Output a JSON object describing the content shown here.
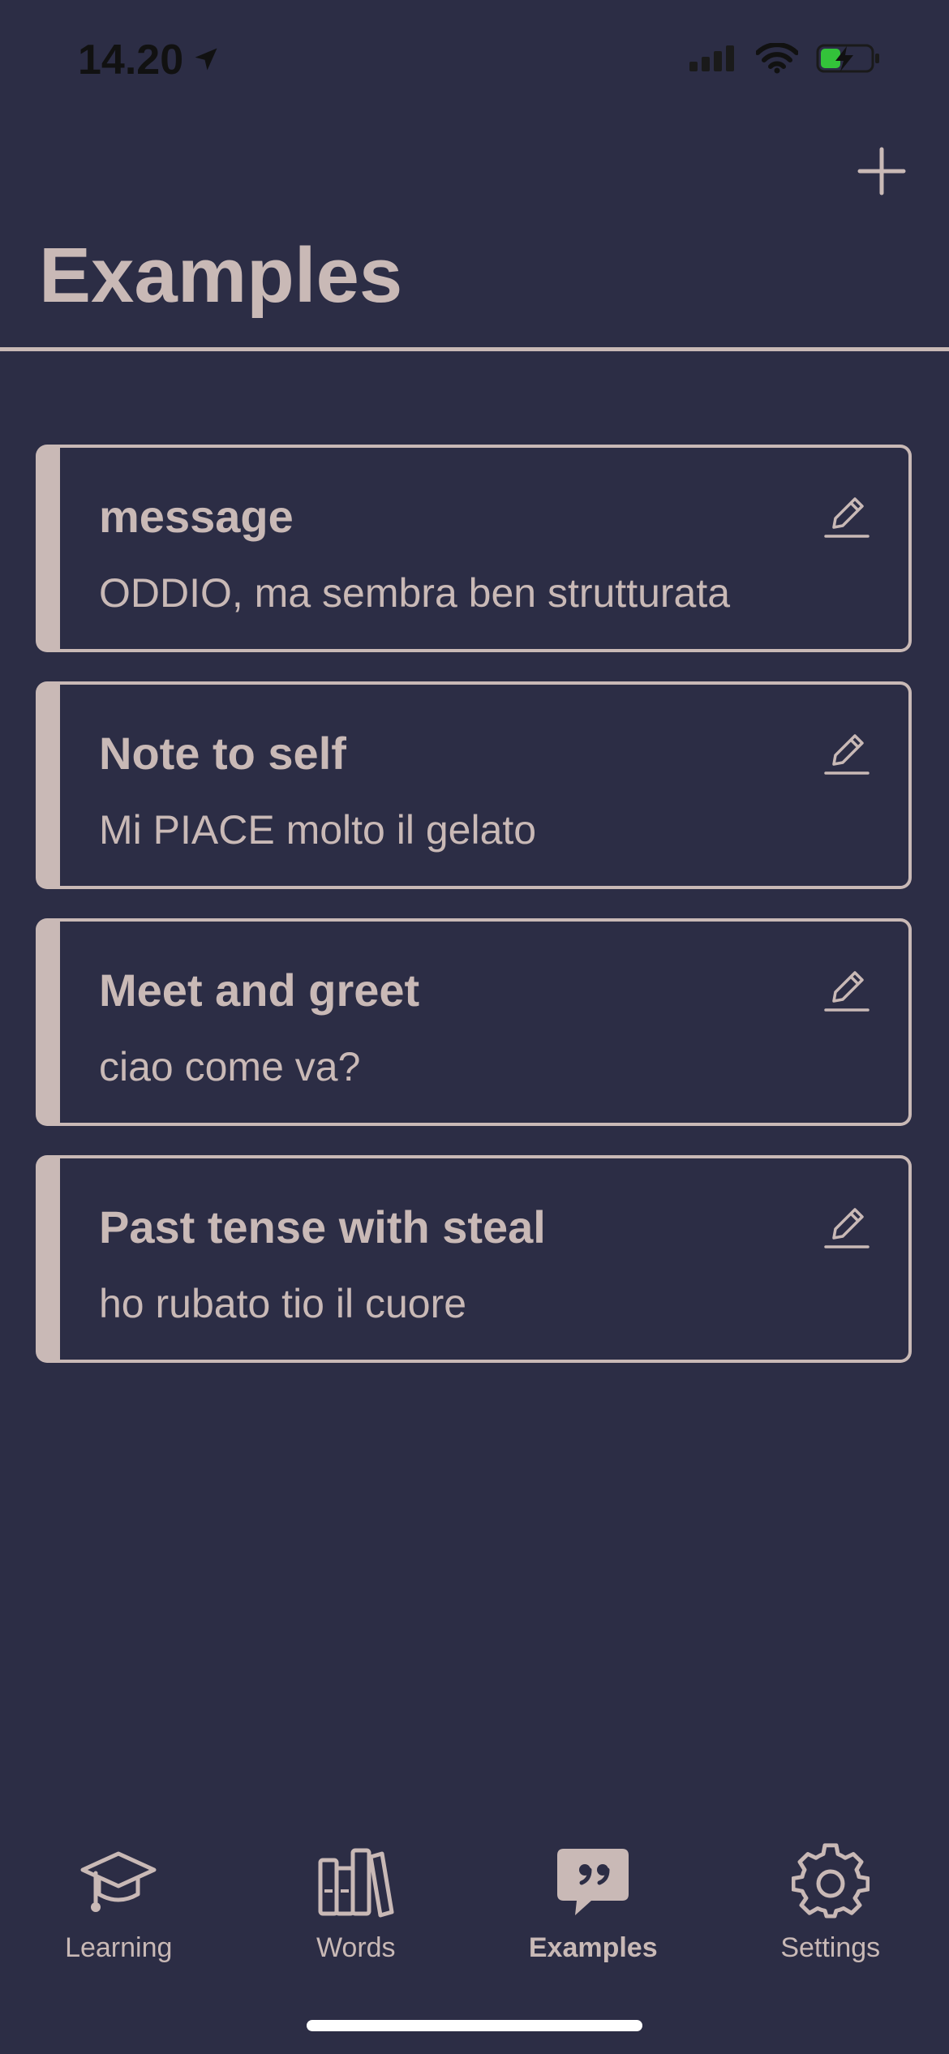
{
  "status_bar": {
    "time": "14.20",
    "location_icon": "location-arrow-icon",
    "signal_icon": "cellular-signal-icon",
    "wifi_icon": "wifi-icon",
    "battery_icon": "battery-charging-icon"
  },
  "header": {
    "title": "Examples",
    "add_icon": "plus-icon"
  },
  "examples": [
    {
      "title": "message",
      "text": "ODDIO, ma sembra ben strutturata"
    },
    {
      "title": "Note to self",
      "text": "Mi PIACE molto il gelato"
    },
    {
      "title": "Meet and greet",
      "text": "ciao come va?"
    },
    {
      "title": "Past tense with steal",
      "text": "ho rubato tio il cuore"
    }
  ],
  "tab_bar": {
    "tabs": [
      {
        "label": "Learning",
        "icon": "graduation-cap-icon",
        "active": false
      },
      {
        "label": "Words",
        "icon": "books-icon",
        "active": false
      },
      {
        "label": "Examples",
        "icon": "quote-bubble-icon",
        "active": true
      },
      {
        "label": "Settings",
        "icon": "gear-icon",
        "active": false
      }
    ]
  },
  "colors": {
    "background": "#2c2d45",
    "accent": "#c9b9b6",
    "status_text": "#111111"
  }
}
